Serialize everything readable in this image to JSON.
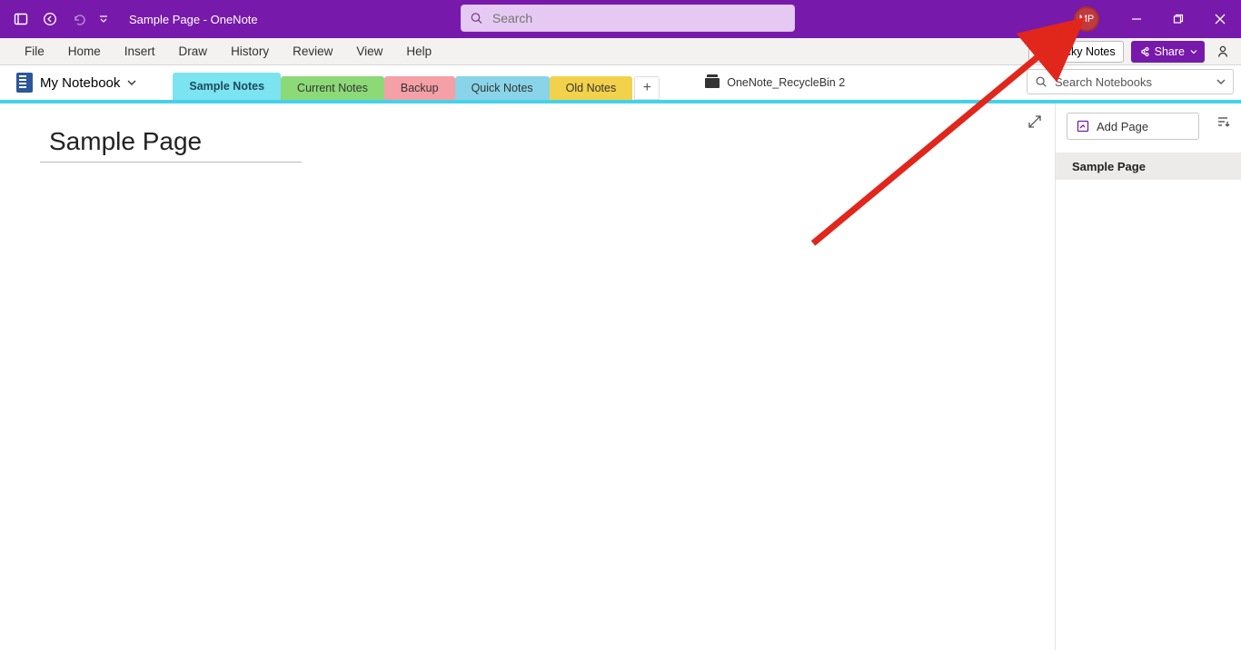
{
  "title": "Sample Page  -  OneNote",
  "search_placeholder": "Search",
  "avatar_initials": "MP",
  "ribbon": [
    "File",
    "Home",
    "Insert",
    "Draw",
    "History",
    "Review",
    "View",
    "Help"
  ],
  "sticky_label": "Sticky Notes",
  "share_label": "Share",
  "notebook_name": "My Notebook",
  "sections": [
    {
      "label": "Sample Notes",
      "color": "#7CE3F0",
      "active": true
    },
    {
      "label": "Current Notes",
      "color": "#8DD978",
      "active": false
    },
    {
      "label": "Backup",
      "color": "#F4A0A6",
      "active": false
    },
    {
      "label": "Quick Notes",
      "color": "#89D4E8",
      "active": false
    },
    {
      "label": "Old Notes",
      "color": "#F3D24B",
      "active": false
    }
  ],
  "recycle_label": "OneNote_RecycleBin 2",
  "nb_search_placeholder": "Search Notebooks",
  "page_title_value": "Sample Page",
  "add_page_label": "Add Page",
  "pages": [
    "Sample Page"
  ]
}
